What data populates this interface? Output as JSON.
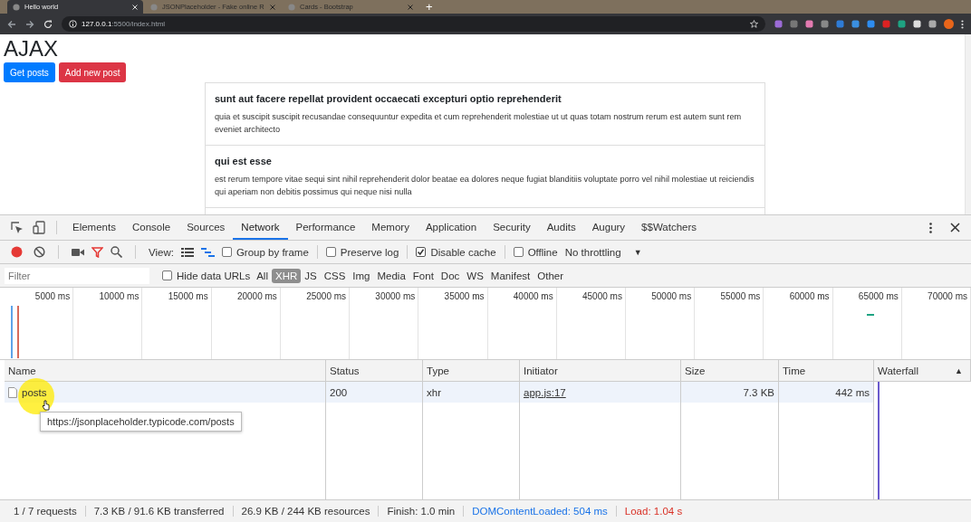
{
  "browser": {
    "tabs": [
      {
        "title": "Hello world",
        "selected": true
      },
      {
        "title": "JSONPlaceholder - Fake online R",
        "selected": false
      },
      {
        "title": "Cards - Bootstrap",
        "selected": false
      }
    ],
    "new_tab": "+",
    "url_host": "127.0.0.1",
    "url_path": ":5500/index.html"
  },
  "page": {
    "heading": "AJAX",
    "buttons": [
      {
        "label": "Get posts",
        "kind": "primary"
      },
      {
        "label": "Add new post",
        "kind": "danger"
      }
    ],
    "posts": [
      {
        "title": "sunt aut facere repellat provident occaecati excepturi optio reprehenderit",
        "body": "quia et suscipit suscipit recusandae consequuntur expedita et cum reprehenderit molestiae ut ut quas totam nostrum rerum est autem sunt rem eveniet architecto"
      },
      {
        "title": "qui est esse",
        "body": "est rerum tempore vitae sequi sint nihil reprehenderit dolor beatae ea dolores neque fugiat blanditiis voluptate porro vel nihil molestiae ut reiciendis qui aperiam non debitis possimus qui neque nisi nulla"
      }
    ]
  },
  "devtools": {
    "panels": [
      {
        "label": "Elements",
        "selected": false
      },
      {
        "label": "Console",
        "selected": false
      },
      {
        "label": "Sources",
        "selected": false
      },
      {
        "label": "Network",
        "selected": true
      },
      {
        "label": "Performance",
        "selected": false
      },
      {
        "label": "Memory",
        "selected": false
      },
      {
        "label": "Application",
        "selected": false
      },
      {
        "label": "Security",
        "selected": false
      },
      {
        "label": "Audits",
        "selected": false
      },
      {
        "label": "Augury",
        "selected": false
      },
      {
        "label": "$$Watchers",
        "selected": false
      }
    ],
    "toolbar": {
      "recording": true,
      "filter_on": true,
      "view_label": "View:",
      "options": [
        {
          "label": "Group by frame",
          "checked": false
        },
        {
          "label": "Preserve log",
          "checked": false
        },
        {
          "label": "Disable cache",
          "checked": true
        },
        {
          "label": "Offline",
          "checked": false
        }
      ],
      "throttling": "No throttling",
      "throttling_caret": "▼"
    },
    "filter": {
      "placeholder": "Filter",
      "hide_data_urls": {
        "label": "Hide data URLs",
        "checked": false
      },
      "types": [
        {
          "label": "All",
          "selected": false
        },
        {
          "label": "XHR",
          "selected": true
        },
        {
          "label": "JS",
          "selected": false
        },
        {
          "label": "CSS",
          "selected": false
        },
        {
          "label": "Img",
          "selected": false
        },
        {
          "label": "Media",
          "selected": false
        },
        {
          "label": "Font",
          "selected": false
        },
        {
          "label": "Doc",
          "selected": false
        },
        {
          "label": "WS",
          "selected": false
        },
        {
          "label": "Manifest",
          "selected": false
        },
        {
          "label": "Other",
          "selected": false
        }
      ]
    },
    "overview": {
      "ticks": [
        "5000 ms",
        "10000 ms",
        "15000 ms",
        "20000 ms",
        "25000 ms",
        "30000 ms",
        "35000 ms",
        "40000 ms",
        "45000 ms",
        "50000 ms",
        "55000 ms",
        "60000 ms",
        "65000 ms",
        "70000 ms"
      ]
    },
    "table": {
      "columns": [
        "Name",
        "Status",
        "Type",
        "Initiator",
        "Size",
        "Time",
        "Waterfall"
      ],
      "sort_indicator": "▲",
      "rows": [
        {
          "name": "posts",
          "status": "200",
          "type": "xhr",
          "initiator": "app.js:17",
          "size": "7.3 KB",
          "time": "442 ms",
          "selected": true
        }
      ]
    },
    "tooltip": "https://jsonplaceholder.typicode.com/posts",
    "status_bar": [
      {
        "text": "1 / 7 requests",
        "kind": "plain"
      },
      {
        "text": "7.3 KB / 91.6 KB transferred",
        "kind": "plain"
      },
      {
        "text": "26.9 KB / 244 KB resources",
        "kind": "plain"
      },
      {
        "text": "Finish: 1.0 min",
        "kind": "plain"
      },
      {
        "text": "DOMContentLoaded: 504 ms",
        "kind": "dom"
      },
      {
        "text": "Load: 1.04 s",
        "kind": "load"
      }
    ]
  }
}
